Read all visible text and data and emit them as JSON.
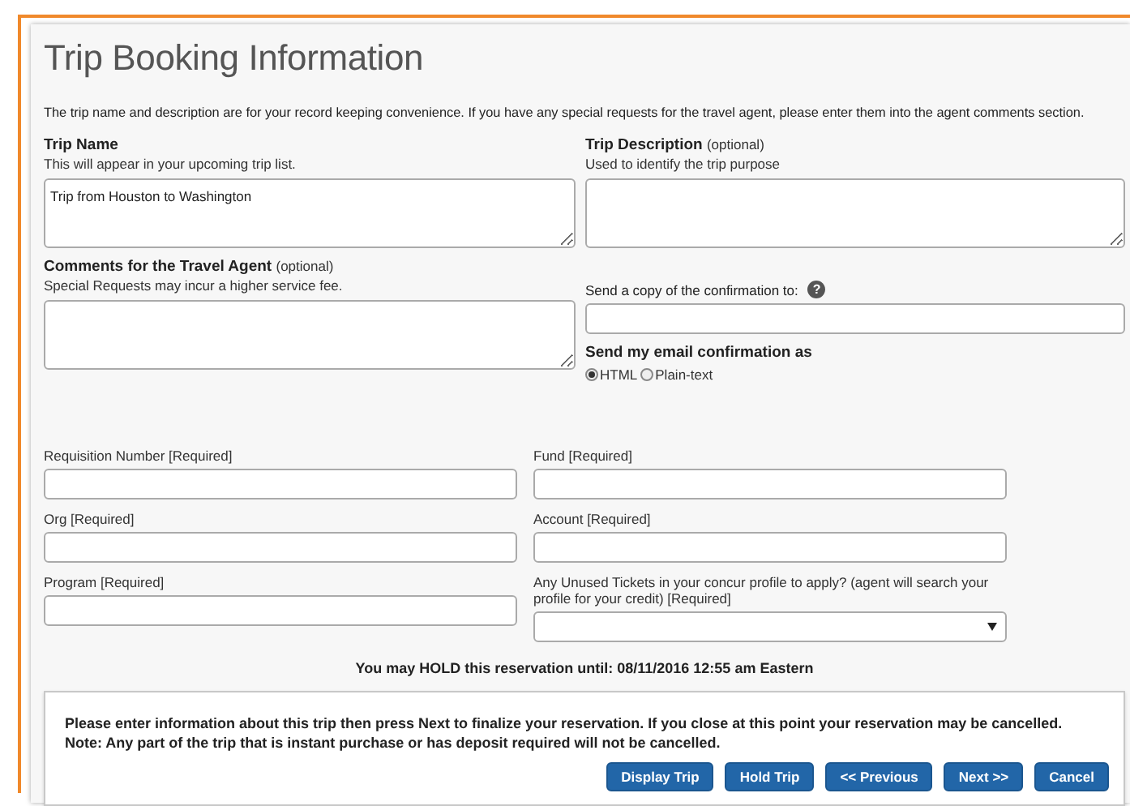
{
  "title": "Trip Booking Information",
  "intro": "The trip name and description are for your record keeping convenience. If you have any special requests for the travel agent, please enter them into the agent comments section.",
  "trip_name": {
    "label": "Trip Name",
    "hint": "This will appear in your upcoming trip list.",
    "value": "Trip from Houston to Washington"
  },
  "trip_description": {
    "label": "Trip Description",
    "note": "(optional)",
    "hint": "Used to identify the trip purpose"
  },
  "agent_comments": {
    "label": "Comments for the Travel Agent",
    "note": "(optional)",
    "hint": "Special Requests may incur a higher service fee."
  },
  "confirmation_copy": {
    "label": "Send a copy of the confirmation to:",
    "help": "?"
  },
  "email_format": {
    "label": "Send my email confirmation as",
    "options": [
      {
        "label": "HTML",
        "selected": true
      },
      {
        "label": "Plain-text",
        "selected": false
      }
    ]
  },
  "required_fields": [
    {
      "kind": "text",
      "label": "Requisition Number [Required]"
    },
    {
      "kind": "text",
      "label": "Fund [Required]"
    },
    {
      "kind": "text",
      "label": "Org [Required]"
    },
    {
      "kind": "text",
      "label": "Account [Required]"
    },
    {
      "kind": "text",
      "label": "Program [Required]"
    },
    {
      "kind": "select",
      "label": "Any Unused Tickets in your concur profile to apply? (agent will search your profile for your credit) [Required]"
    }
  ],
  "hold_notice": "You may HOLD this reservation until: 08/11/2016 12:55 am Eastern",
  "footer": {
    "message": "Please enter information about this trip then press Next to finalize your reservation. If you close at this point your reservation may be cancelled.",
    "note": "Note: Any part of the trip that is instant purchase or has deposit required will not be cancelled.",
    "buttons": [
      "Display Trip",
      "Hold Trip",
      "<< Previous",
      "Next >>",
      "Cancel"
    ]
  }
}
